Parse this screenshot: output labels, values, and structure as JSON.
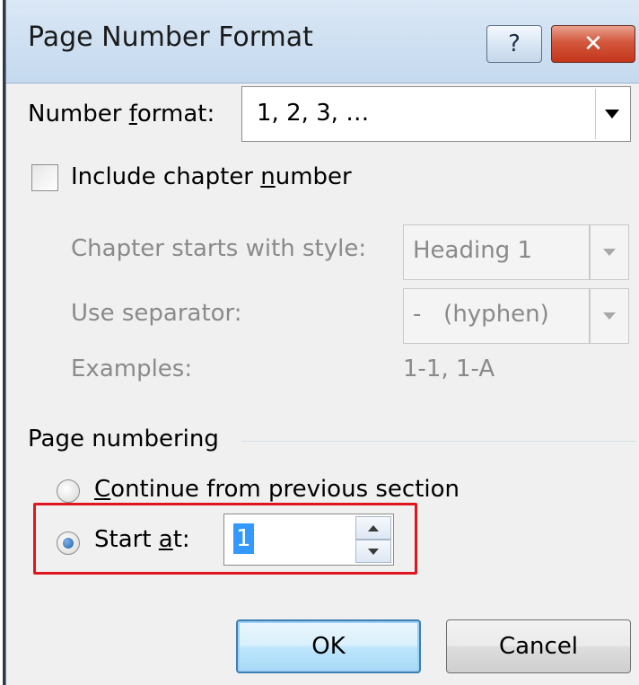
{
  "dialog": {
    "title": "Page Number Format",
    "help_glyph": "?",
    "close_glyph": "✕"
  },
  "number_format": {
    "label_prefix": "Number ",
    "label_accel": "f",
    "label_suffix": "ormat:",
    "value": "1, 2, 3, …"
  },
  "chapter": {
    "include_prefix": "Include chapter ",
    "include_accel": "n",
    "include_suffix": "umber",
    "checked": false,
    "starts_with_label": "Chapter starts with style:",
    "style_value": "Heading 1",
    "separator_label": "Use separator:",
    "separator_value": "-   (hyphen)",
    "examples_label": "Examples:",
    "examples_value": "1-1, 1-A"
  },
  "page_numbering": {
    "group_label": "Page numbering",
    "continue_accel": "C",
    "continue_suffix": "ontinue from previous section",
    "start_prefix": "Start ",
    "start_accel": "a",
    "start_suffix": "t:",
    "start_value": "1",
    "selected": "start_at"
  },
  "buttons": {
    "ok": "OK",
    "cancel": "Cancel"
  },
  "colors": {
    "highlight": "#e0161e",
    "selection": "#3399ff"
  }
}
